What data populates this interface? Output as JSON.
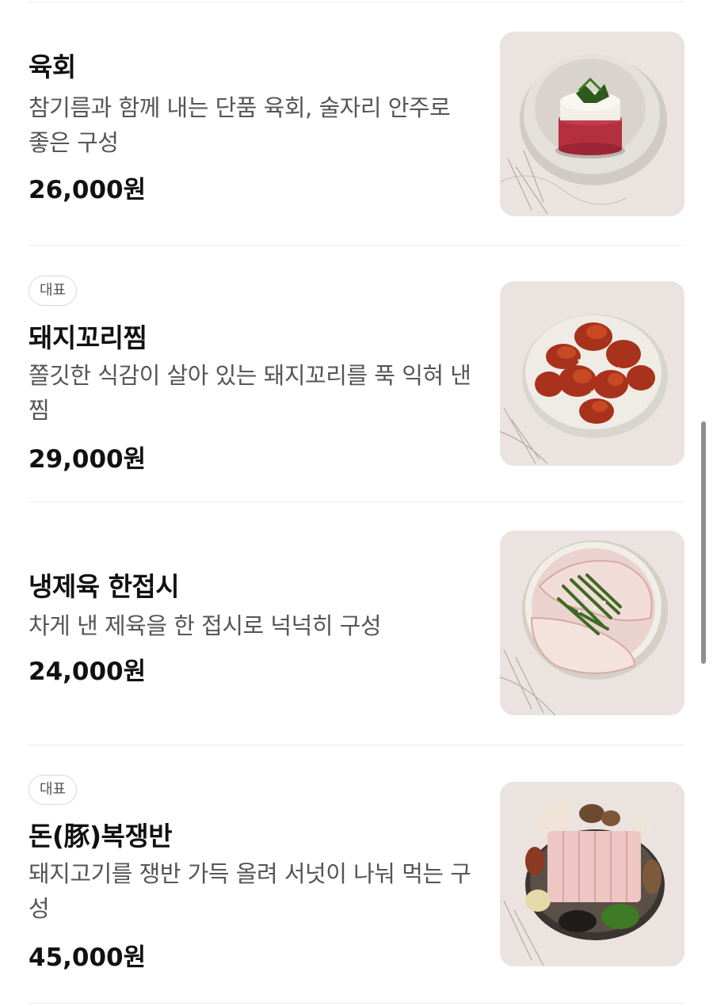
{
  "menu": {
    "items": [
      {
        "name": "육회",
        "description": "참기름과 함께 내는 단품 육회, 술자리 안주로 좋은 구성",
        "price": "26,000원",
        "badge": null,
        "image": "yukhoe-image"
      },
      {
        "name": "돼지꼬리찜",
        "description": "쫄깃한 식감이 살아 있는 돼지꼬리를 푹 익혀 낸 찜",
        "price": "29,000원",
        "badge": "대표",
        "image": "braised-pork-tail-image"
      },
      {
        "name": "냉제육 한접시",
        "description": "차게 낸 제육을 한 접시로 넉넉히 구성",
        "price": "24,000원",
        "badge": null,
        "image": "cold-pork-plate-image"
      },
      {
        "name": "돈(豚)복쟁반",
        "description": "돼지고기를 쟁반 가득 올려 서넛이 나눠 먹는 구성",
        "price": "45,000원",
        "badge": "대표",
        "image": "pork-platter-image"
      }
    ]
  },
  "colors": {
    "text_primary": "#111111",
    "text_secondary": "#555555",
    "divider": "#ececec",
    "badge_border": "#d8d8d8",
    "image_background": "#ebe3df",
    "scrollbar": "#8e8e8e"
  }
}
